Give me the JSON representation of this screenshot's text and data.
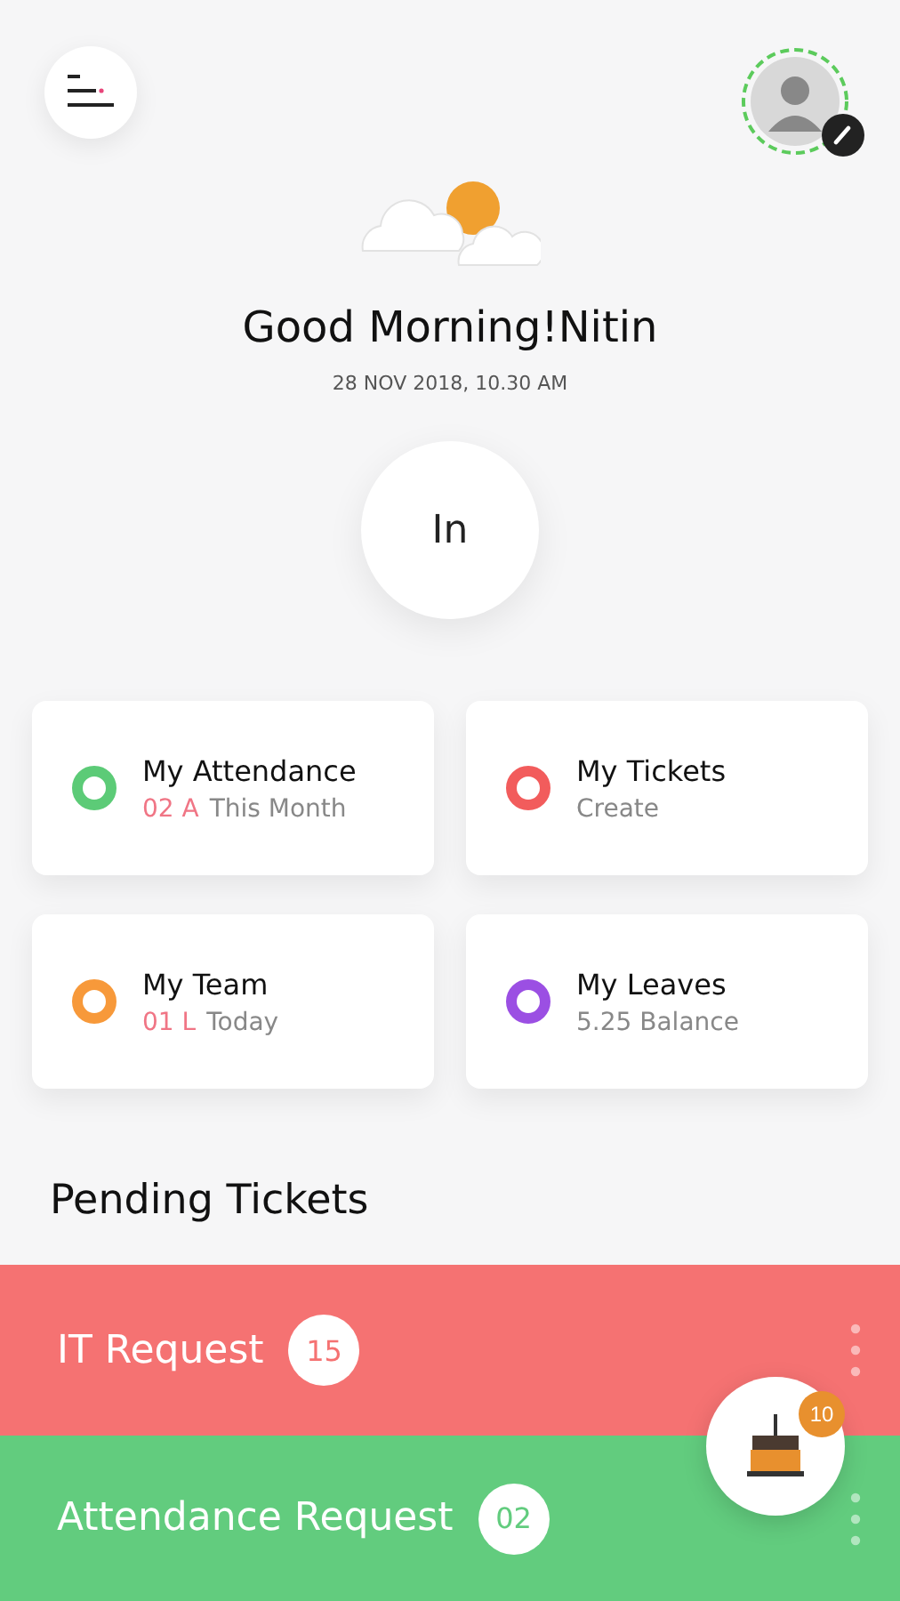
{
  "greeting": "Good Morning!Nitin",
  "datetime": "28 NOV 2018, 10.30 AM",
  "punch_button": "In",
  "cards": [
    {
      "title": "My Attendance",
      "count": "02 A",
      "text": "This Month",
      "color": "#5ccb77"
    },
    {
      "title": "My Tickets",
      "text": "Create",
      "color": "#f25c5c"
    },
    {
      "title": "My Team",
      "count": "01 L",
      "text": "Today",
      "color": "#f7993a"
    },
    {
      "title": "My Leaves",
      "text": "5.25 Balance",
      "color": "#9b4fe3"
    }
  ],
  "pending_title": "Pending Tickets",
  "pending": [
    {
      "label": "IT Request",
      "count": "15",
      "color": "#f57272"
    },
    {
      "label": "Attendance Request",
      "count": "02",
      "color": "#62cc7e"
    }
  ],
  "birthday_badge": "10"
}
